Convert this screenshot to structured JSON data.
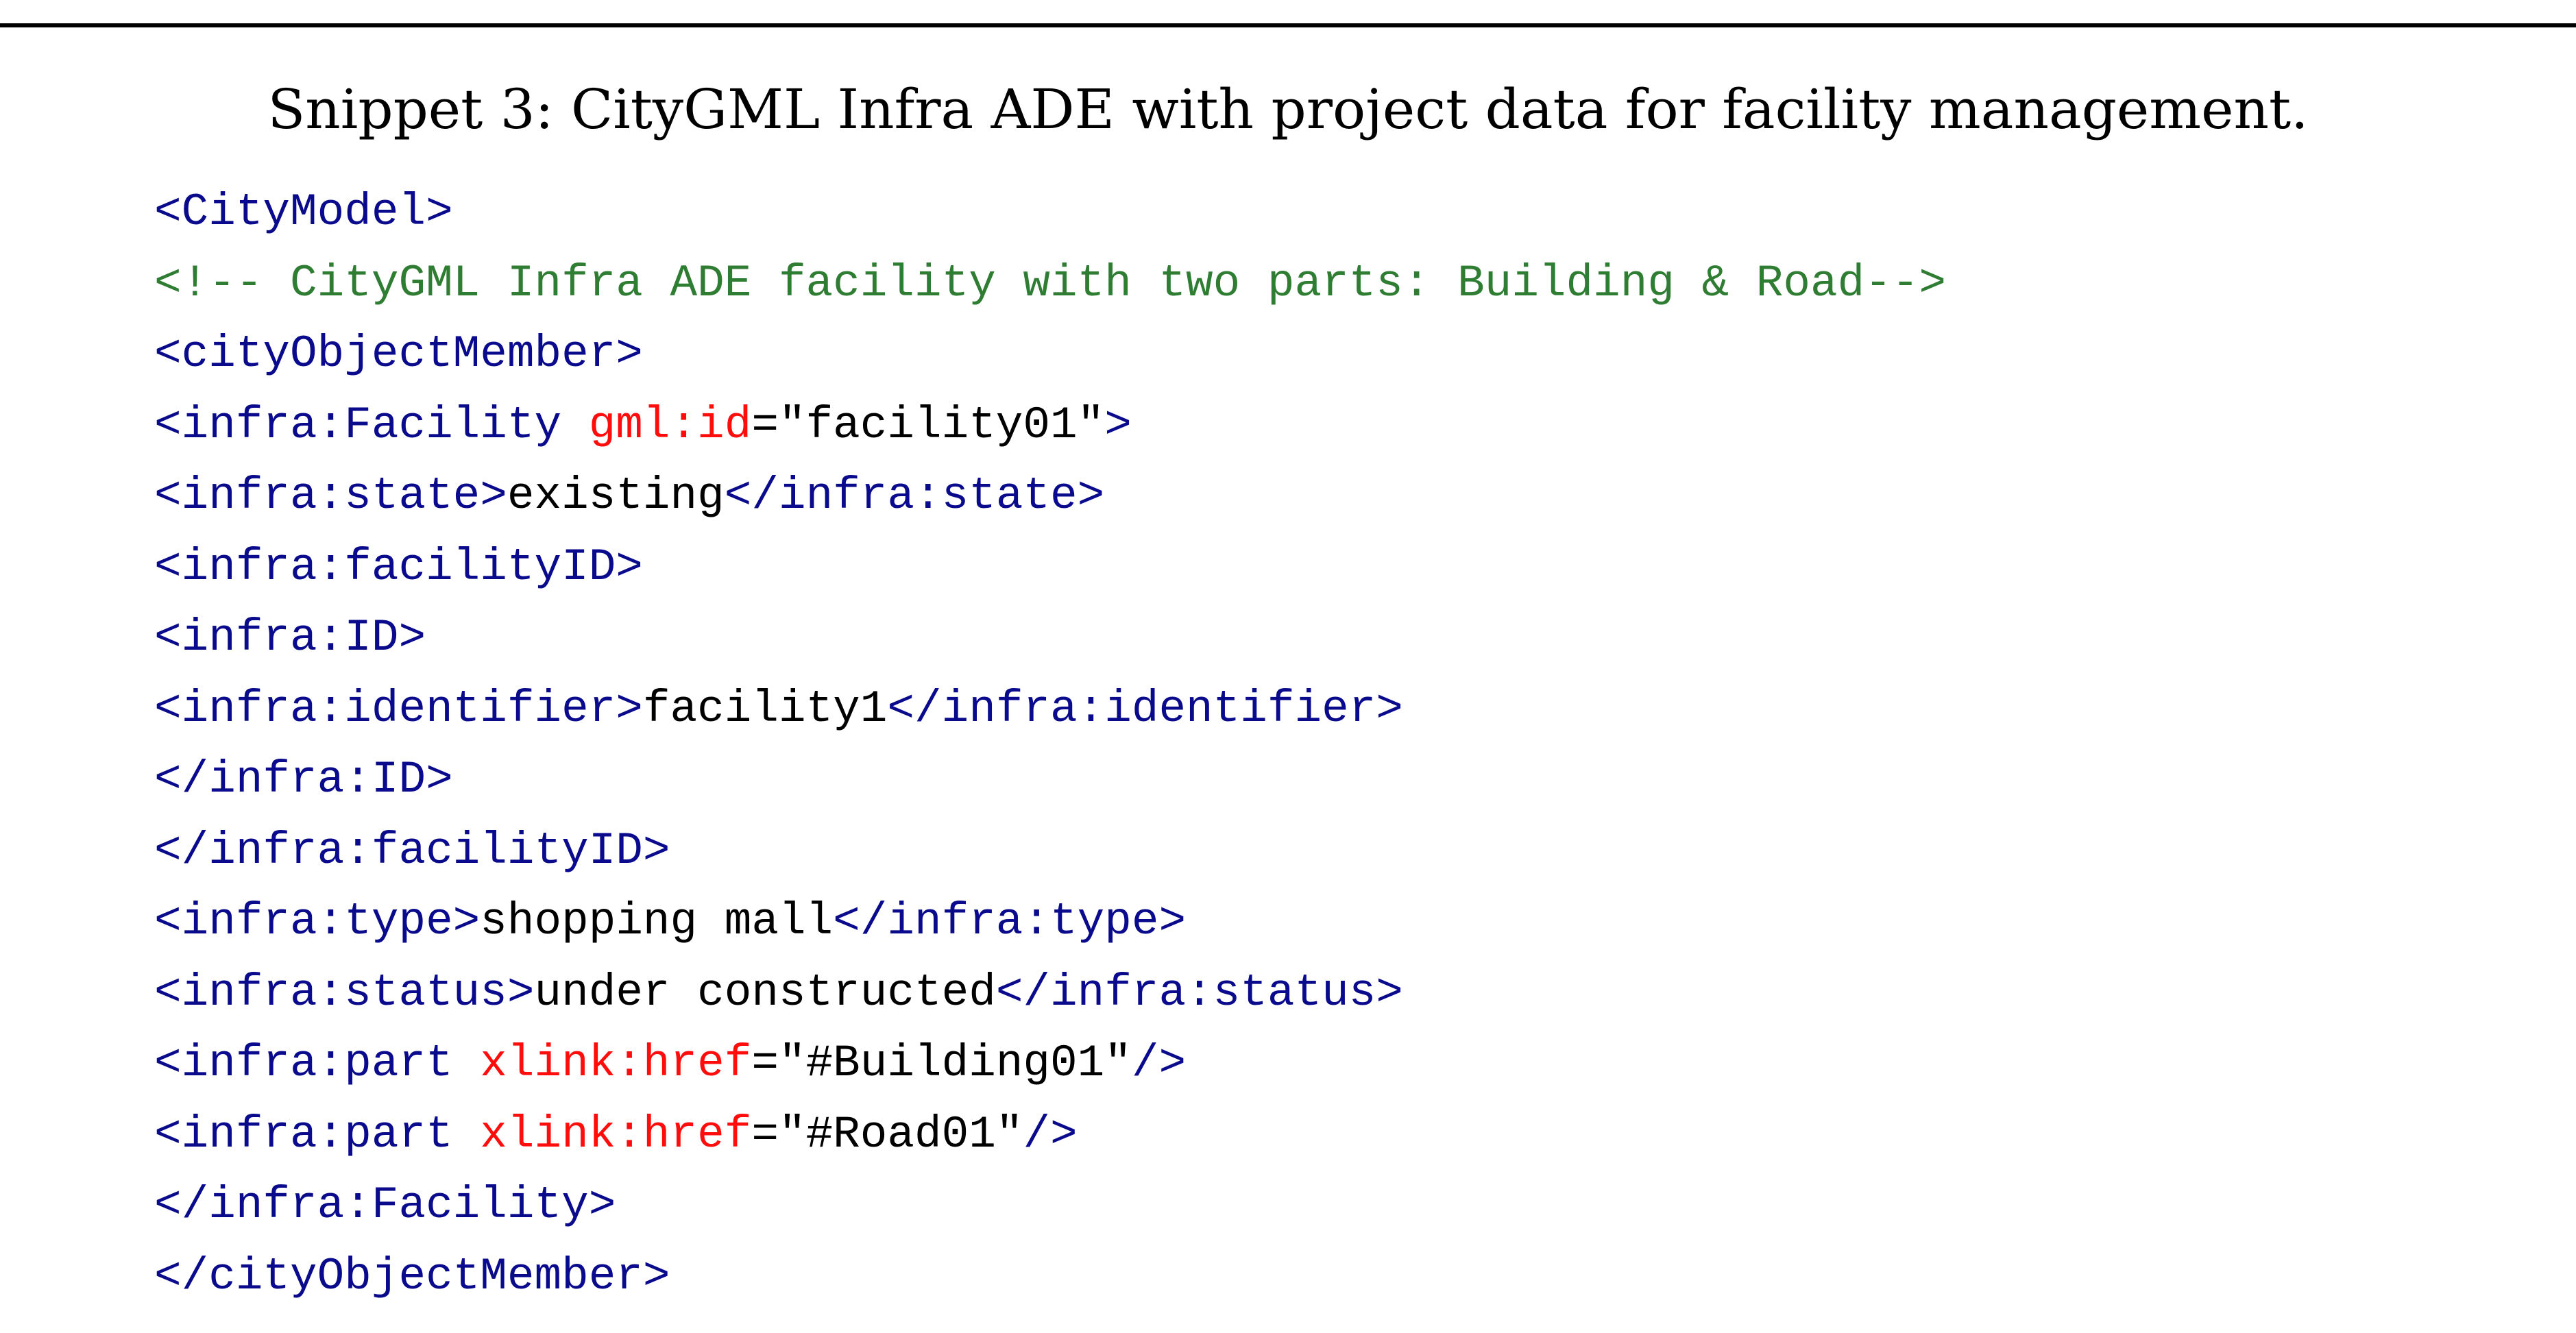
{
  "caption": "Snippet 3: CityGML Infra ADE with project data for facility management.",
  "colors": {
    "tag": "#0a0a8c",
    "attribute": "#ff0d0d",
    "text": "#000000",
    "comment": "#2e7d32"
  },
  "code_lines": [
    [
      {
        "t": "tag",
        "v": "<CityModel>"
      }
    ],
    [
      {
        "t": "comment",
        "v": "<!-- CityGML Infra ADE facility with two parts: Building & Road-->"
      }
    ],
    [
      {
        "t": "tag",
        "v": "<cityObjectMember>"
      }
    ],
    [
      {
        "t": "tag",
        "v": "<infra:Facility "
      },
      {
        "t": "attr",
        "v": "gml:id"
      },
      {
        "t": "text",
        "v": "=\"facility01\""
      },
      {
        "t": "tag",
        "v": ">"
      }
    ],
    [
      {
        "t": "tag",
        "v": "<infra:state>"
      },
      {
        "t": "text",
        "v": "existing"
      },
      {
        "t": "tag",
        "v": "</infra:state>"
      }
    ],
    [
      {
        "t": "tag",
        "v": "<infra:facilityID>"
      }
    ],
    [
      {
        "t": "tag",
        "v": "<infra:ID>"
      }
    ],
    [
      {
        "t": "tag",
        "v": "<infra:identifier>"
      },
      {
        "t": "text",
        "v": "facility1"
      },
      {
        "t": "tag",
        "v": "</infra:identifier>"
      }
    ],
    [
      {
        "t": "tag",
        "v": "</infra:ID>"
      }
    ],
    [
      {
        "t": "tag",
        "v": "</infra:facilityID>"
      }
    ],
    [
      {
        "t": "tag",
        "v": "<infra:type>"
      },
      {
        "t": "text",
        "v": "shopping mall"
      },
      {
        "t": "tag",
        "v": "</infra:type>"
      }
    ],
    [
      {
        "t": "tag",
        "v": "<infra:status>"
      },
      {
        "t": "text",
        "v": "under constructed"
      },
      {
        "t": "tag",
        "v": "</infra:status>"
      }
    ],
    [
      {
        "t": "tag",
        "v": "<infra:part "
      },
      {
        "t": "attr",
        "v": "xlink:href"
      },
      {
        "t": "text",
        "v": "=\"#Building01\""
      },
      {
        "t": "tag",
        "v": "/>"
      }
    ],
    [
      {
        "t": "tag",
        "v": "<infra:part "
      },
      {
        "t": "attr",
        "v": "xlink:href"
      },
      {
        "t": "text",
        "v": "=\"#Road01\""
      },
      {
        "t": "tag",
        "v": "/>"
      }
    ],
    [
      {
        "t": "tag",
        "v": "</infra:Facility>"
      }
    ],
    [
      {
        "t": "tag",
        "v": "</cityObjectMember>"
      }
    ]
  ]
}
